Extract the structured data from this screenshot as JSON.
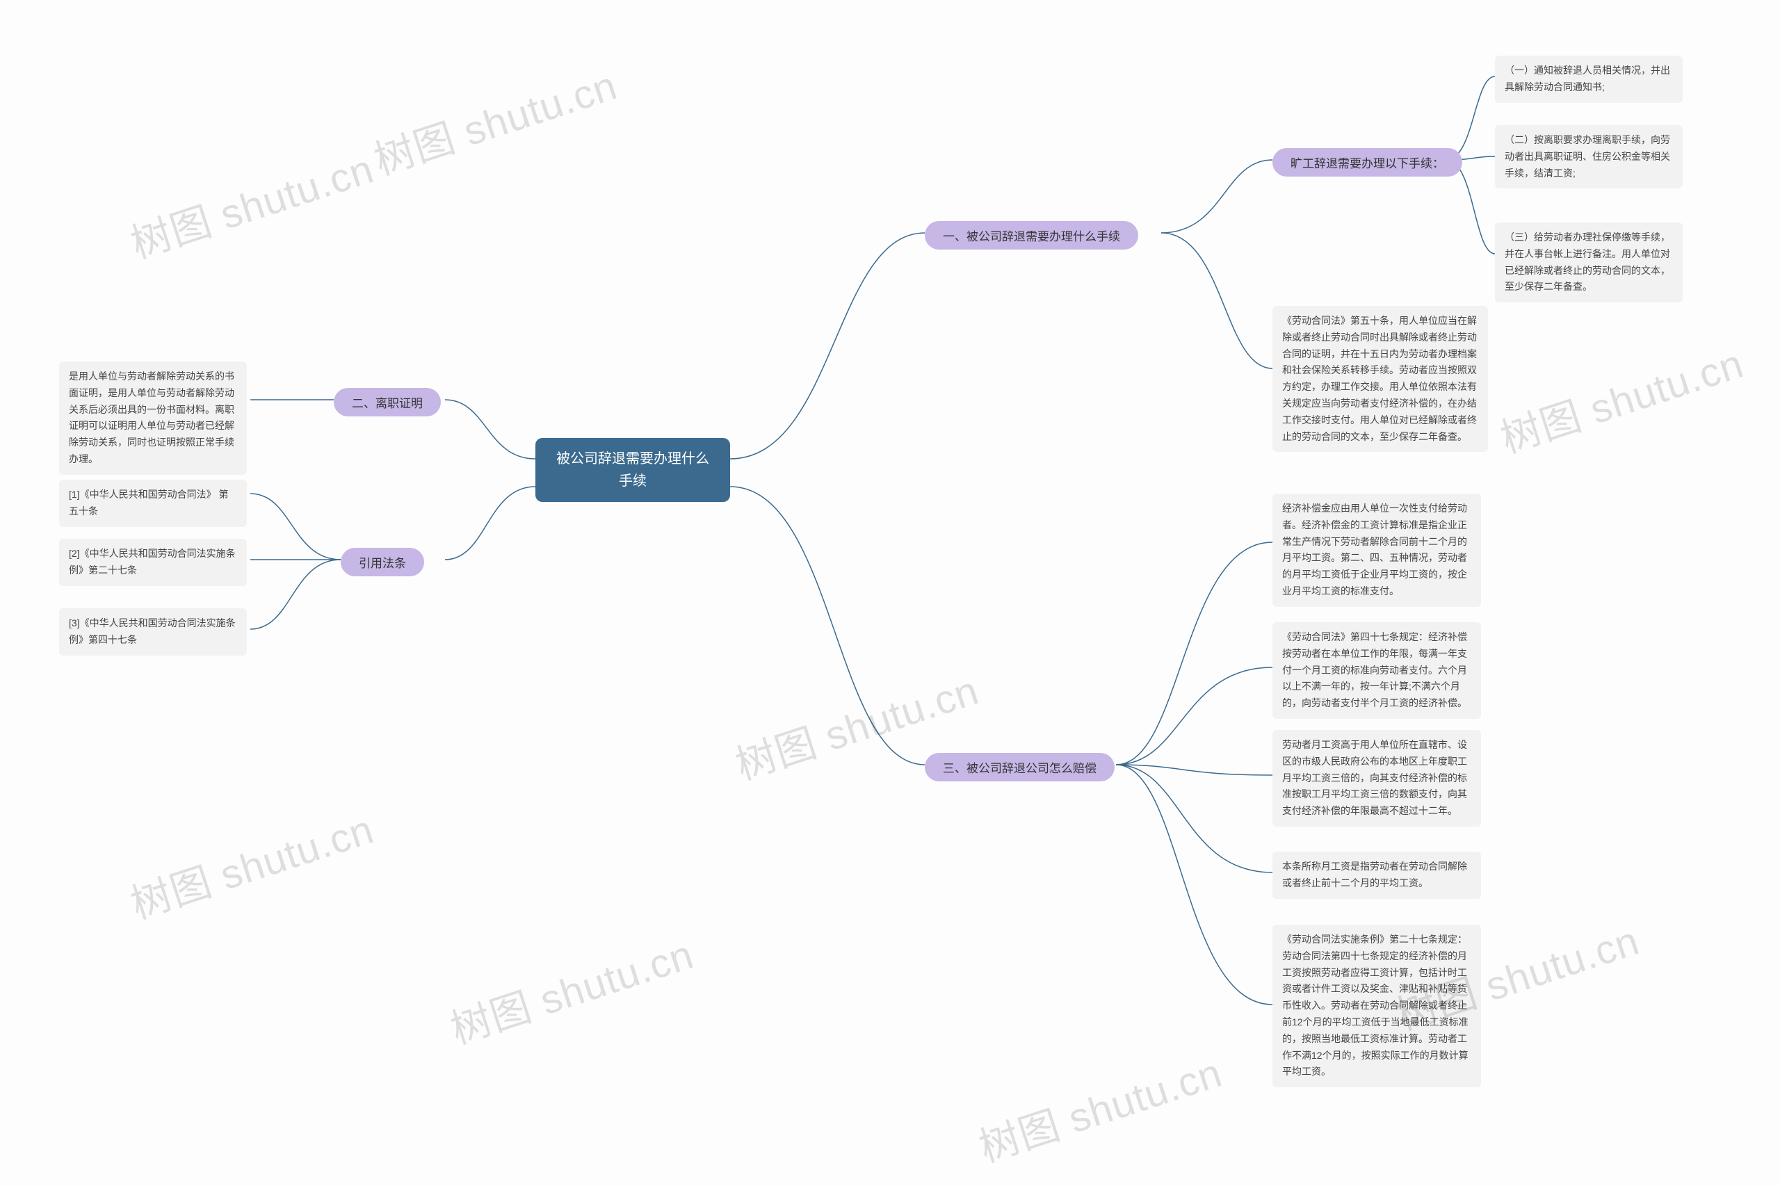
{
  "root": {
    "title_l1": "被公司辞退需要办理什么",
    "title_l2": "手续"
  },
  "b1": {
    "label": "一、被公司辞退需要办理什么手续",
    "sub": {
      "label": "旷工辞退需要办理以下手续："
    },
    "leaves": [
      "（一）通知被辞退人员相关情况，并出具解除劳动合同通知书;",
      "（二）按离职要求办理离职手续，向劳动者出具离职证明、住房公积金等相关手续，结清工资;",
      "（三）给劳动者办理社保停缴等手续，并在人事台帐上进行备注。用人单位对已经解除或者终止的劳动合同的文本，至少保存二年备查。"
    ],
    "law": "《劳动合同法》第五十条，用人单位应当在解除或者终止劳动合同时出具解除或者终止劳动合同的证明，并在十五日内为劳动者办理档案和社会保险关系转移手续。劳动者应当按照双方约定，办理工作交接。用人单位依照本法有关规定应当向劳动者支付经济补偿的，在办结工作交接时支付。用人单位对已经解除或者终止的劳动合同的文本，至少保存二年备查。"
  },
  "b2": {
    "label": "二、离职证明",
    "leaf": "是用人单位与劳动者解除劳动关系的书面证明，是用人单位与劳动者解除劳动关系后必须出具的一份书面材料。离职证明可以证明用人单位与劳动者已经解除劳动关系，同时也证明按照正常手续办理。"
  },
  "b3": {
    "label": "三、被公司辞退公司怎么赔偿",
    "leaves": [
      "经济补偿金应由用人单位一次性支付给劳动者。经济补偿金的工资计算标准是指企业正常生产情况下劳动者解除合同前十二个月的月平均工资。第二、四、五种情况，劳动者的月平均工资低于企业月平均工资的，按企业月平均工资的标准支付。",
      "《劳动合同法》第四十七条规定：经济补偿按劳动者在本单位工作的年限，每满一年支付一个月工资的标准向劳动者支付。六个月以上不满一年的，按一年计算;不满六个月的，向劳动者支付半个月工资的经济补偿。",
      "劳动者月工资高于用人单位所在直辖市、设区的市级人民政府公布的本地区上年度职工月平均工资三倍的，向其支付经济补偿的标准按职工月平均工资三倍的数额支付，向其支付经济补偿的年限最高不超过十二年。",
      "本条所称月工资是指劳动者在劳动合同解除或者终止前十二个月的平均工资。",
      "《劳动合同法实施条例》第二十七条规定：劳动合同法第四十七条规定的经济补偿的月工资按照劳动者应得工资计算，包括计时工资或者计件工资以及奖金、津贴和补贴等货币性收入。劳动者在劳动合同解除或者终止前12个月的平均工资低于当地最低工资标准的，按照当地最低工资标准计算。劳动者工作不满12个月的，按照实际工作的月数计算平均工资。"
    ]
  },
  "b4": {
    "label": "引用法条",
    "leaves": [
      "[1]《中华人民共和国劳动合同法》 第五十条",
      "[2]《中华人民共和国劳动合同法实施条例》第二十七条",
      "[3]《中华人民共和国劳动合同法实施条例》第四十七条"
    ]
  },
  "watermark": "树图 shutu.cn"
}
